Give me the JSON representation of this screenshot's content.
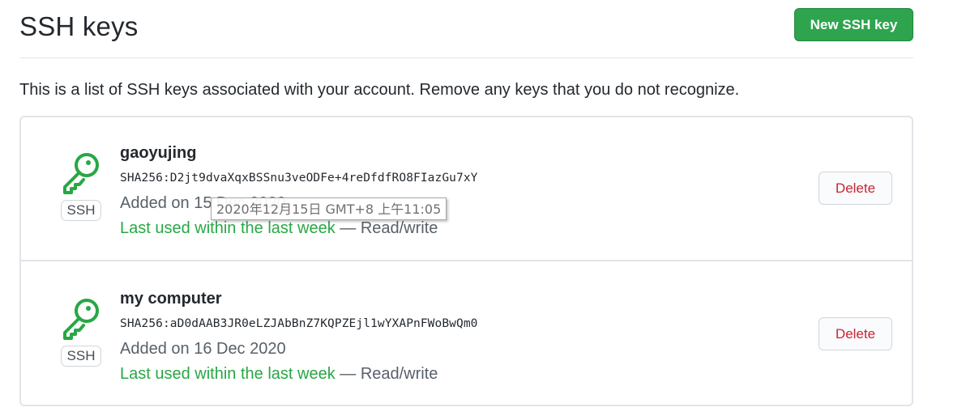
{
  "header": {
    "title": "SSH keys",
    "new_key_button": "New SSH key"
  },
  "description": "This is a list of SSH keys associated with your account. Remove any keys that you do not recognize.",
  "keys": [
    {
      "title": "gaoyujing",
      "fingerprint": "SHA256:D2jt9dvaXqxBSSnu3veODFe+4reDfdfRO8FIazGu7xY",
      "added": "Added on 15 Dec 2020",
      "last_used": "Last used within the last week",
      "access": " — Read/write",
      "badge": "SSH",
      "delete_label": "Delete",
      "icon": "key-icon"
    },
    {
      "title": "my computer",
      "fingerprint": "SHA256:aD0dAAB3JR0eLZJAbBnZ7KQPZEjl1wYXAPnFWoBwQm0",
      "added": "Added on 16 Dec 2020",
      "last_used": "Last used within the last week",
      "access": " — Read/write",
      "badge": "SSH",
      "delete_label": "Delete",
      "icon": "key-icon"
    }
  ],
  "tooltip": "2020年12月15日 GMT+8 上午11:05",
  "colors": {
    "primary_button": "#2ea44f",
    "key_icon": "#28a745",
    "danger": "#cb2431",
    "border": "#e1e4e8"
  }
}
